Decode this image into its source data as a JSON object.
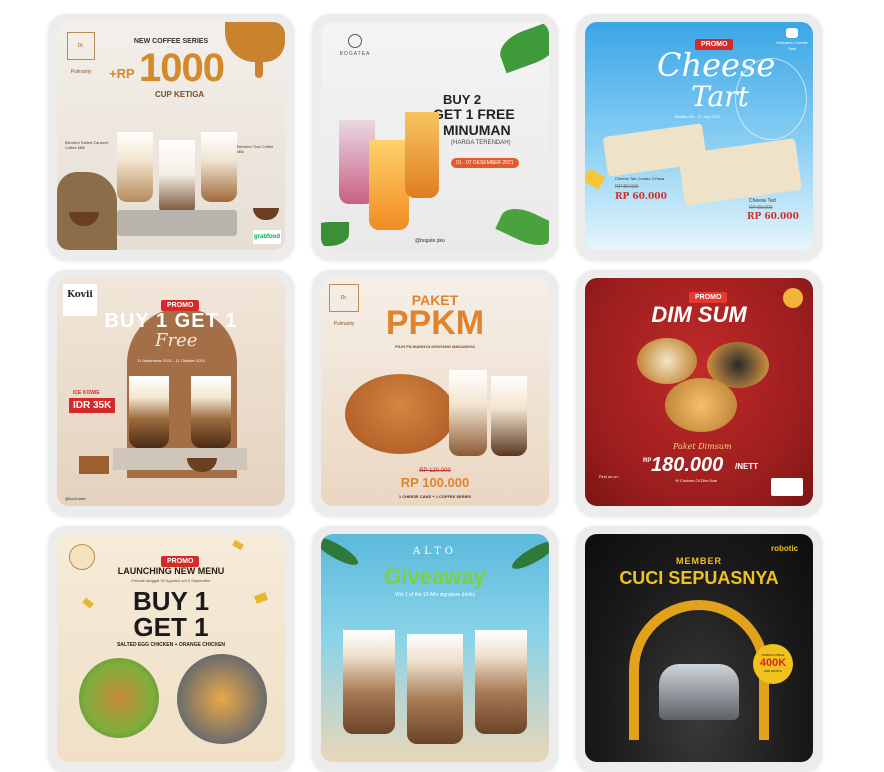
{
  "cards": [
    {
      "headline": "NEW COFFEE SERIES",
      "price_prefix": "+RP",
      "price": "1000",
      "subline": "CUP KETIGA",
      "logo_text": "Dr. Pulmanty",
      "label_a": "Blended Salted Caramel Coffee Milk",
      "label_b": "Blended Coffee Milk",
      "label_c": "Blended Thai Coffee Milk",
      "available": "grabfood"
    },
    {
      "brand": "BOGATEA",
      "line1": "BUY 2",
      "line2": "GET 1 FREE",
      "line3": "MINUMAN",
      "line4": "(HARGA TERENDAH)",
      "date": "01 - 07 DESEMBER 2021",
      "handle": "@bogate.pku"
    },
    {
      "badge": "PROMO",
      "title1": "Cheese",
      "title2": "Tart",
      "subtitle": "Berlaku 09 - 11 July 2021",
      "item1": "Cheese Tart Combo 3 Rasa",
      "old1": "RP 80.000",
      "price1": "RP 60.000",
      "item2": "Cheese Tart",
      "old2": "RP 80.000",
      "price2": "RP 60.000",
      "logo_text": "Hokkaido Cheese Tarts"
    },
    {
      "brand": "Kovii",
      "badge": "PROMO",
      "title": "BUY 1 GET 1",
      "free": "Free",
      "date": "11 September 2021 - 11 Oktober 2021",
      "product": "ICE KOWIE",
      "price": "IDR 35K",
      "footer": "@kovii.kafe"
    },
    {
      "title1": "PAKET",
      "title2": "PPKM",
      "subtitle": "PILIH PILIHANNYA KENYANG MAKANNYA",
      "old_price": "RP 120.000",
      "price": "RP 100.000",
      "footer": "1 CHEESE CAKE + 1 COFFEE SERIES",
      "logo_text": "Dr. Pulmanty"
    },
    {
      "badge": "PROMO",
      "title": "DIM SUM",
      "package": "Paket Dimsum",
      "price_prefix": "RP",
      "price": "180.000",
      "suffix": "/NETT",
      "choices": "*8 Choices Of Dim Sum",
      "find": "Find us on :"
    },
    {
      "badge": "PROMO",
      "title": "LAUNCHING NEW MENU",
      "date": "Periode tanggal 30 Agustus s/d 5 September",
      "line1": "BUY 1",
      "line2": "GET 1",
      "footer": "SALTED EGG CHICKEN + ORANGE CHICKEN"
    },
    {
      "brand": "ALTO",
      "title": "Giveaway",
      "subtitle": "Win 1 of the 10 Alto signature drinks"
    },
    {
      "brand": "robotic",
      "line1": "MEMBER",
      "line2": "CUCI SEPUASNYA",
      "promo_label": "NORMAL PRICE",
      "promo_price": "400K",
      "promo_note": "PER MONTH"
    }
  ]
}
